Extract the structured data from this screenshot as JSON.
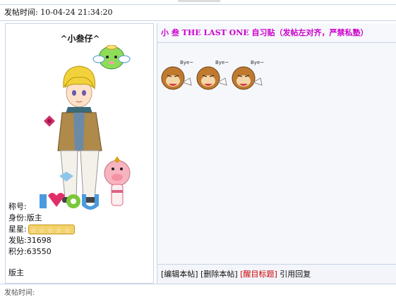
{
  "post": {
    "time_label": "发帖时间:",
    "time_value": "10-04-24 21:34:20"
  },
  "author": {
    "name": "^小叁仔^",
    "fields": [
      {
        "label": "称号:",
        "value": ""
      },
      {
        "label": "身份:",
        "value": "版主"
      },
      {
        "label": "星星:",
        "value": ""
      },
      {
        "label": "发贴:",
        "value": "31698"
      },
      {
        "label": "积分:",
        "value": "63550"
      }
    ],
    "star_count": 5,
    "role_footer": "版主"
  },
  "thread": {
    "title": "小 叁 THE LAST ONE 自习贴（发帖左对齐，严禁私塾）"
  },
  "stickers": [
    {
      "label": "Bye~"
    },
    {
      "label": "Bye~"
    },
    {
      "label": "Bye~"
    }
  ],
  "actions": {
    "edit": "[编辑本帖]",
    "delete": "[删除本帖]",
    "highlight": "[醒目标题]",
    "quote": "引用回复"
  },
  "bottom_text": "发帖时间:",
  "colors": {
    "title": "#cc00cc",
    "border": "#c9d3e6",
    "highlight": "#cc0000"
  }
}
